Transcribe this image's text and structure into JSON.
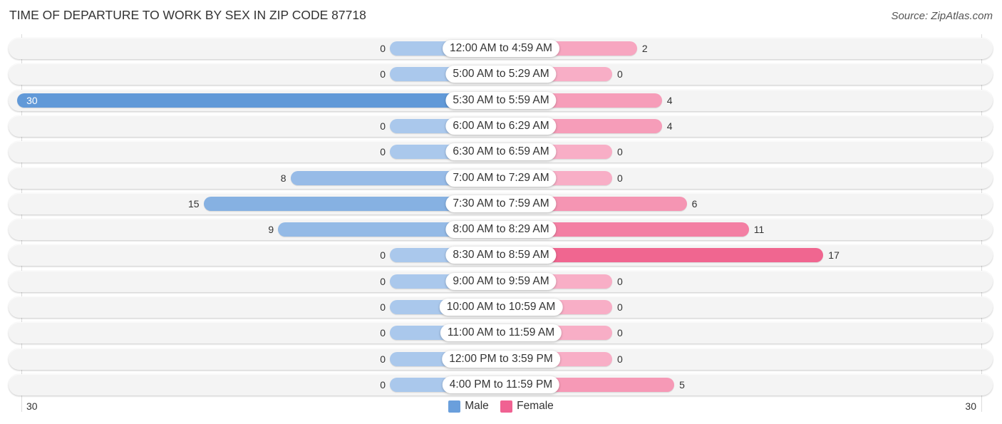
{
  "chart_data": {
    "type": "bar",
    "orientation": "horizontal-diverging",
    "title": "TIME OF DEPARTURE TO WORK BY SEX IN ZIP CODE 87718",
    "source": "Source: ZipAtlas.com",
    "categories": [
      "12:00 AM to 4:59 AM",
      "5:00 AM to 5:29 AM",
      "5:30 AM to 5:59 AM",
      "6:00 AM to 6:29 AM",
      "6:30 AM to 6:59 AM",
      "7:00 AM to 7:29 AM",
      "7:30 AM to 7:59 AM",
      "8:00 AM to 8:29 AM",
      "8:30 AM to 8:59 AM",
      "9:00 AM to 9:59 AM",
      "10:00 AM to 10:59 AM",
      "11:00 AM to 11:59 AM",
      "12:00 PM to 3:59 PM",
      "4:00 PM to 11:59 PM"
    ],
    "series": [
      {
        "name": "Male",
        "values": [
          0,
          0,
          30,
          0,
          0,
          8,
          15,
          9,
          0,
          0,
          0,
          0,
          0,
          0
        ],
        "color": "#6a9fdc",
        "color_light": "#aac8ec",
        "color_strong": "#6199d8"
      },
      {
        "name": "Female",
        "values": [
          2,
          0,
          4,
          4,
          0,
          0,
          6,
          11,
          17,
          0,
          0,
          0,
          0,
          5
        ],
        "color": "#f06292",
        "color_light": "#f8aec6",
        "color_strong": "#f06690"
      }
    ],
    "axis": {
      "left_label": "30",
      "right_label": "30",
      "range": [
        0,
        30
      ]
    },
    "legend": {
      "position": "bottom-center",
      "items": [
        "Male",
        "Female"
      ]
    },
    "grid": false
  }
}
